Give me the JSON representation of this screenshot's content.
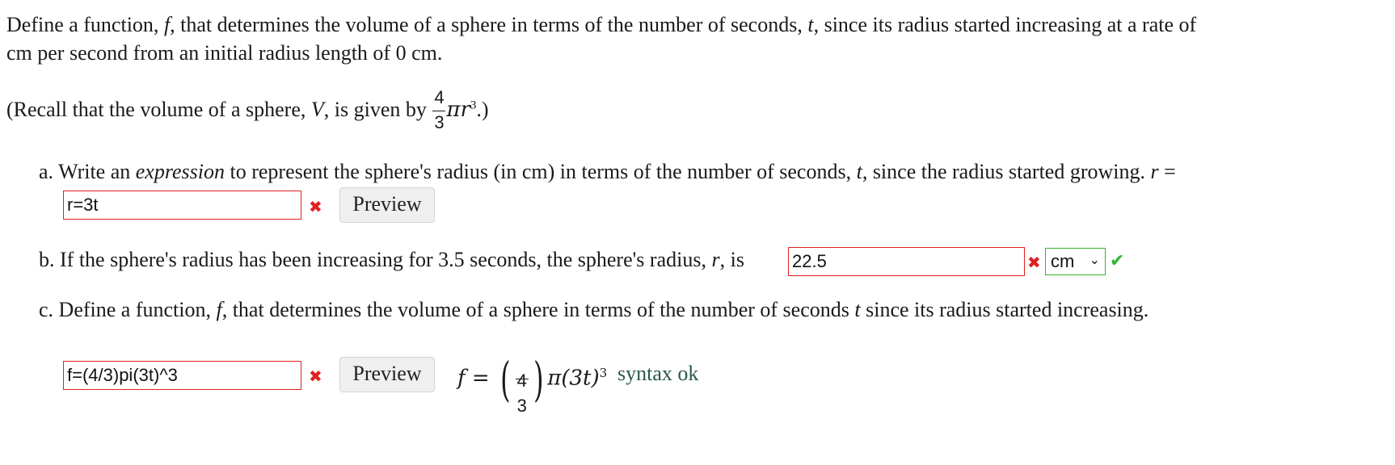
{
  "intro": {
    "line1_part1": "Define a function, ",
    "f": "f",
    "line1_part2": ", that determines the volume of a sphere in terms of the number of seconds, ",
    "t": "t",
    "line1_part3": ", since its radius started increasing at a rate of",
    "line2": "cm per second from an initial radius length of 0 cm."
  },
  "recall": {
    "prefix": "(Recall that the volume of a sphere, ",
    "V": "V",
    "middle": ", is given by ",
    "frac_num": "4",
    "frac_den": "3",
    "pi_r": "πr",
    "exp": "3",
    "suffix": ".)"
  },
  "part_a": {
    "text_part1": "a. Write an ",
    "emph": "expression",
    "text_part2": " to represent the sphere's radius (in cm) in terms of the number of seconds, ",
    "t": "t",
    "text_part3": ", since the radius started growing. ",
    "r": "r",
    "eq": " =",
    "answer": "r=3t",
    "preview_label": "Preview",
    "status": "✖"
  },
  "part_b": {
    "text_part1": "b. If the sphere's radius has been increasing for 3.5 seconds, the sphere's radius, ",
    "r": "r",
    "text_part2": ", is",
    "answer": "22.5",
    "status": "✖",
    "unit_selected": "cm",
    "unit_status": "✔"
  },
  "part_c": {
    "text_part1": "c. Define a function, ",
    "f": "f",
    "text_part2": ", that determines the volume of a sphere in terms of the number of seconds ",
    "t": "t",
    "text_part3": " since its radius started increasing.",
    "answer": "f=(4/3)pi(3t)^3",
    "status": "✖",
    "preview_label": "Preview",
    "preview_f": "f",
    "preview_eq": " = ",
    "preview_lparen": "(",
    "preview_num": "4",
    "preview_den": "3",
    "preview_rparen": ")",
    "preview_body": "π(3t)",
    "preview_exp": "3",
    "syntax_msg": "syntax ok"
  },
  "colors": {
    "error": "#e02020",
    "ok": "#2eb82e",
    "button_bg": "#efefef"
  }
}
